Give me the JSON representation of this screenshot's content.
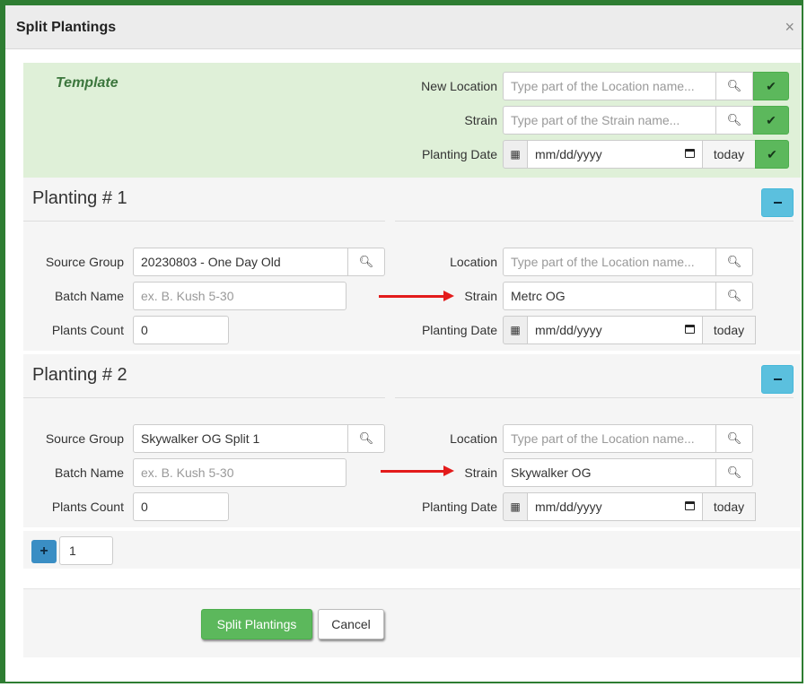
{
  "modal": {
    "title": "Split Plantings",
    "close_label": "×"
  },
  "template": {
    "title": "Template",
    "new_location_label": "New Location",
    "new_location_placeholder": "Type part of the Location name...",
    "strain_label": "Strain",
    "strain_placeholder": "Type part of the Strain name...",
    "planting_date_label": "Planting Date",
    "planting_date_value": "mm/dd/yyyy",
    "today_label": "today",
    "check_icon": "✔"
  },
  "plantings": [
    {
      "title": "Planting # 1",
      "source_group_label": "Source Group",
      "source_group_value": "20230803 - One Day Old",
      "batch_name_label": "Batch Name",
      "batch_name_placeholder": "ex. B. Kush 5-30",
      "plants_count_label": "Plants Count",
      "plants_count_value": "0",
      "location_label": "Location",
      "location_placeholder": "Type part of the Location name...",
      "strain_label": "Strain",
      "strain_value": "Metrc OG",
      "planting_date_label": "Planting Date",
      "planting_date_value": "mm/dd/yyyy",
      "today_label": "today"
    },
    {
      "title": "Planting # 2",
      "source_group_label": "Source Group",
      "source_group_value": "Skywalker OG Split 1",
      "batch_name_label": "Batch Name",
      "batch_name_placeholder": "ex. B. Kush 5-30",
      "plants_count_label": "Plants Count",
      "plants_count_value": "0",
      "location_label": "Location",
      "location_placeholder": "Type part of the Location name...",
      "strain_label": "Strain",
      "strain_value": "Skywalker OG",
      "planting_date_label": "Planting Date",
      "planting_date_value": "mm/dd/yyyy",
      "today_label": "today"
    }
  ],
  "add_row": {
    "plus_label": "+",
    "count_value": "1"
  },
  "actions": {
    "submit_label": "Split Plantings",
    "cancel_label": "Cancel"
  },
  "colors": {
    "accent_green": "#5cb85c",
    "info_blue": "#5bc0de",
    "frame_green": "#2e7d32",
    "arrow_red": "#e31b1b"
  }
}
